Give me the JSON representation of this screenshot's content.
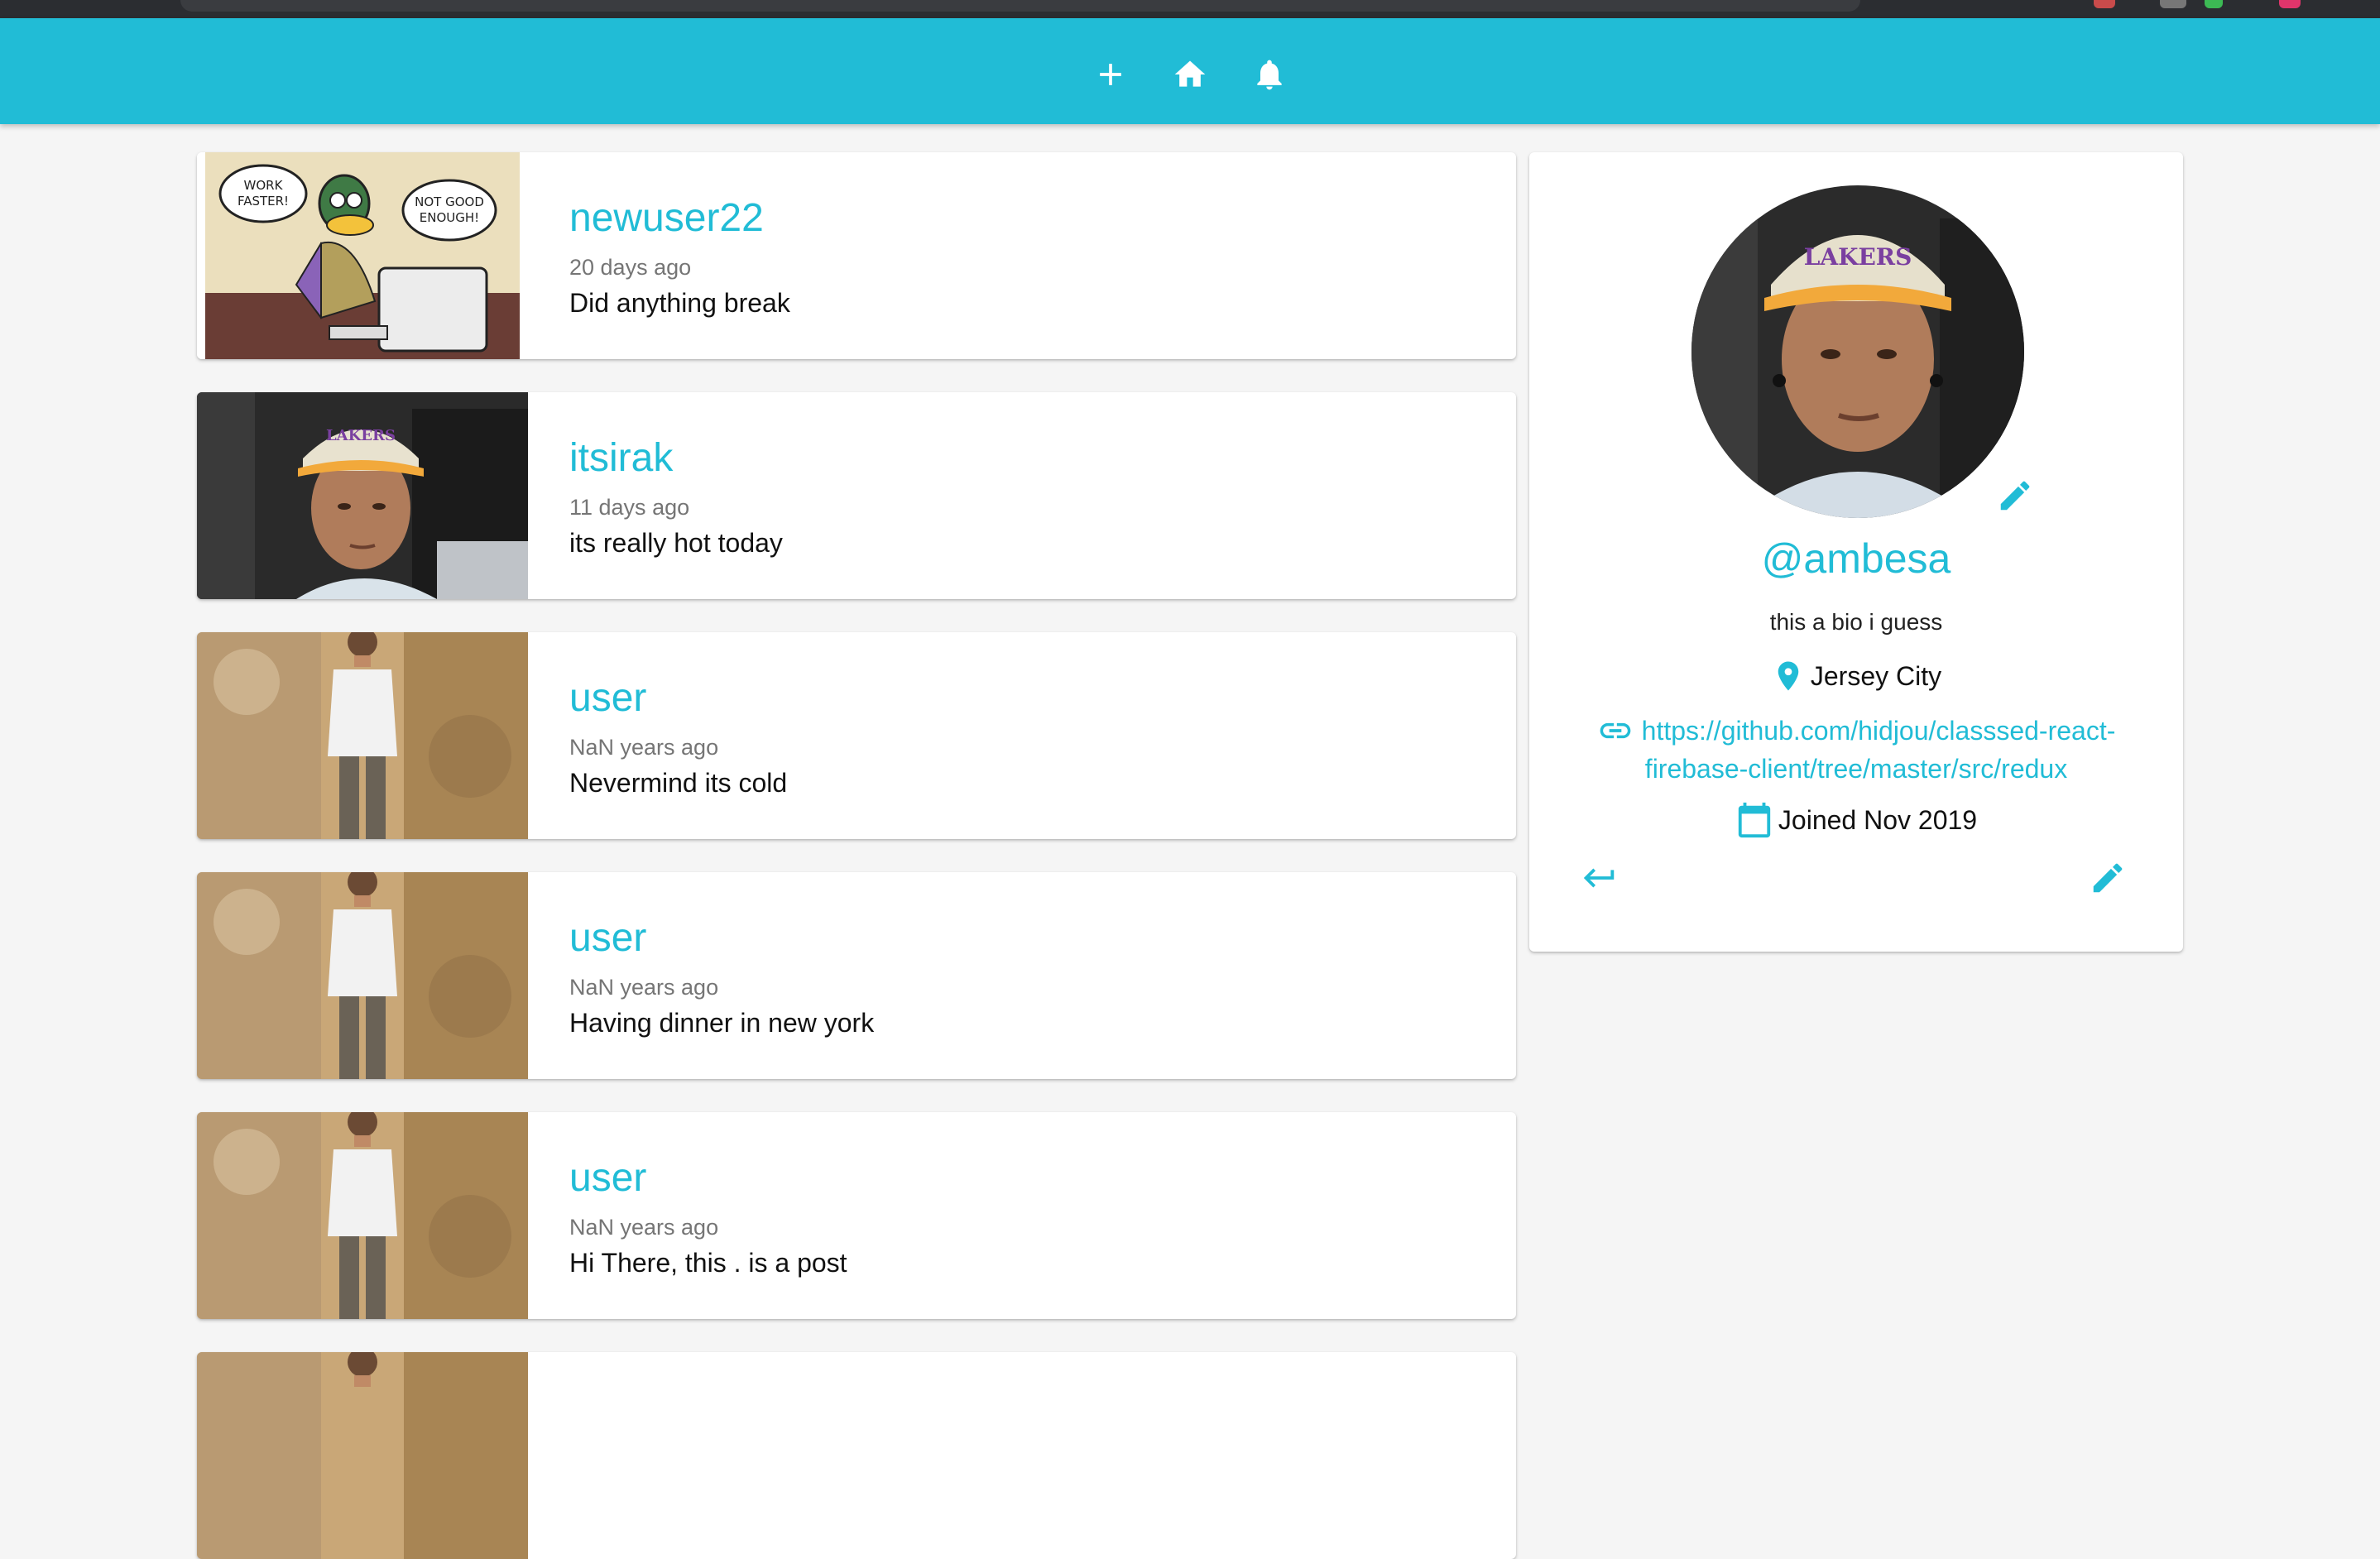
{
  "nav": {
    "icons": [
      "plus-icon",
      "home-icon",
      "bell-icon"
    ]
  },
  "colors": {
    "primary": "#21bcd6",
    "background": "#f5f5f5",
    "card": "#ffffff"
  },
  "posts": [
    {
      "handle": "newuser22",
      "time": "20 days ago",
      "body": "Did anything break",
      "image": "duck-comic"
    },
    {
      "handle": "itsirak",
      "time": "11 days ago",
      "body": "its really hot today",
      "image": "man-in-car"
    },
    {
      "handle": "user",
      "time": "NaN years ago",
      "body": "Nevermind its cold",
      "image": "man-stone-wall"
    },
    {
      "handle": "user",
      "time": "NaN years ago",
      "body": "Having dinner in new york",
      "image": "man-stone-wall"
    },
    {
      "handle": "user",
      "time": "NaN years ago",
      "body": "Hi There, this . is a post",
      "image": "man-stone-wall"
    },
    {
      "handle": "",
      "time": "",
      "body": "",
      "image": "man-stone-wall"
    }
  ],
  "comic": {
    "bubble_left": [
      "WORK",
      "FASTER!"
    ],
    "bubble_right": [
      "NOT GOOD",
      "ENOUGH!"
    ]
  },
  "profile": {
    "handle": "@ambesa",
    "bio": "this a bio i guess",
    "location": "Jersey City",
    "website_line1": "https://github.com/hidjou/classsed-react-",
    "website_line2": "firebase-client/tree/master/src/redux",
    "joined": "Joined Nov 2019",
    "icons": [
      "edit-image-icon",
      "location-pin-icon",
      "link-icon",
      "calendar-icon",
      "logout-icon",
      "edit-profile-icon"
    ]
  }
}
